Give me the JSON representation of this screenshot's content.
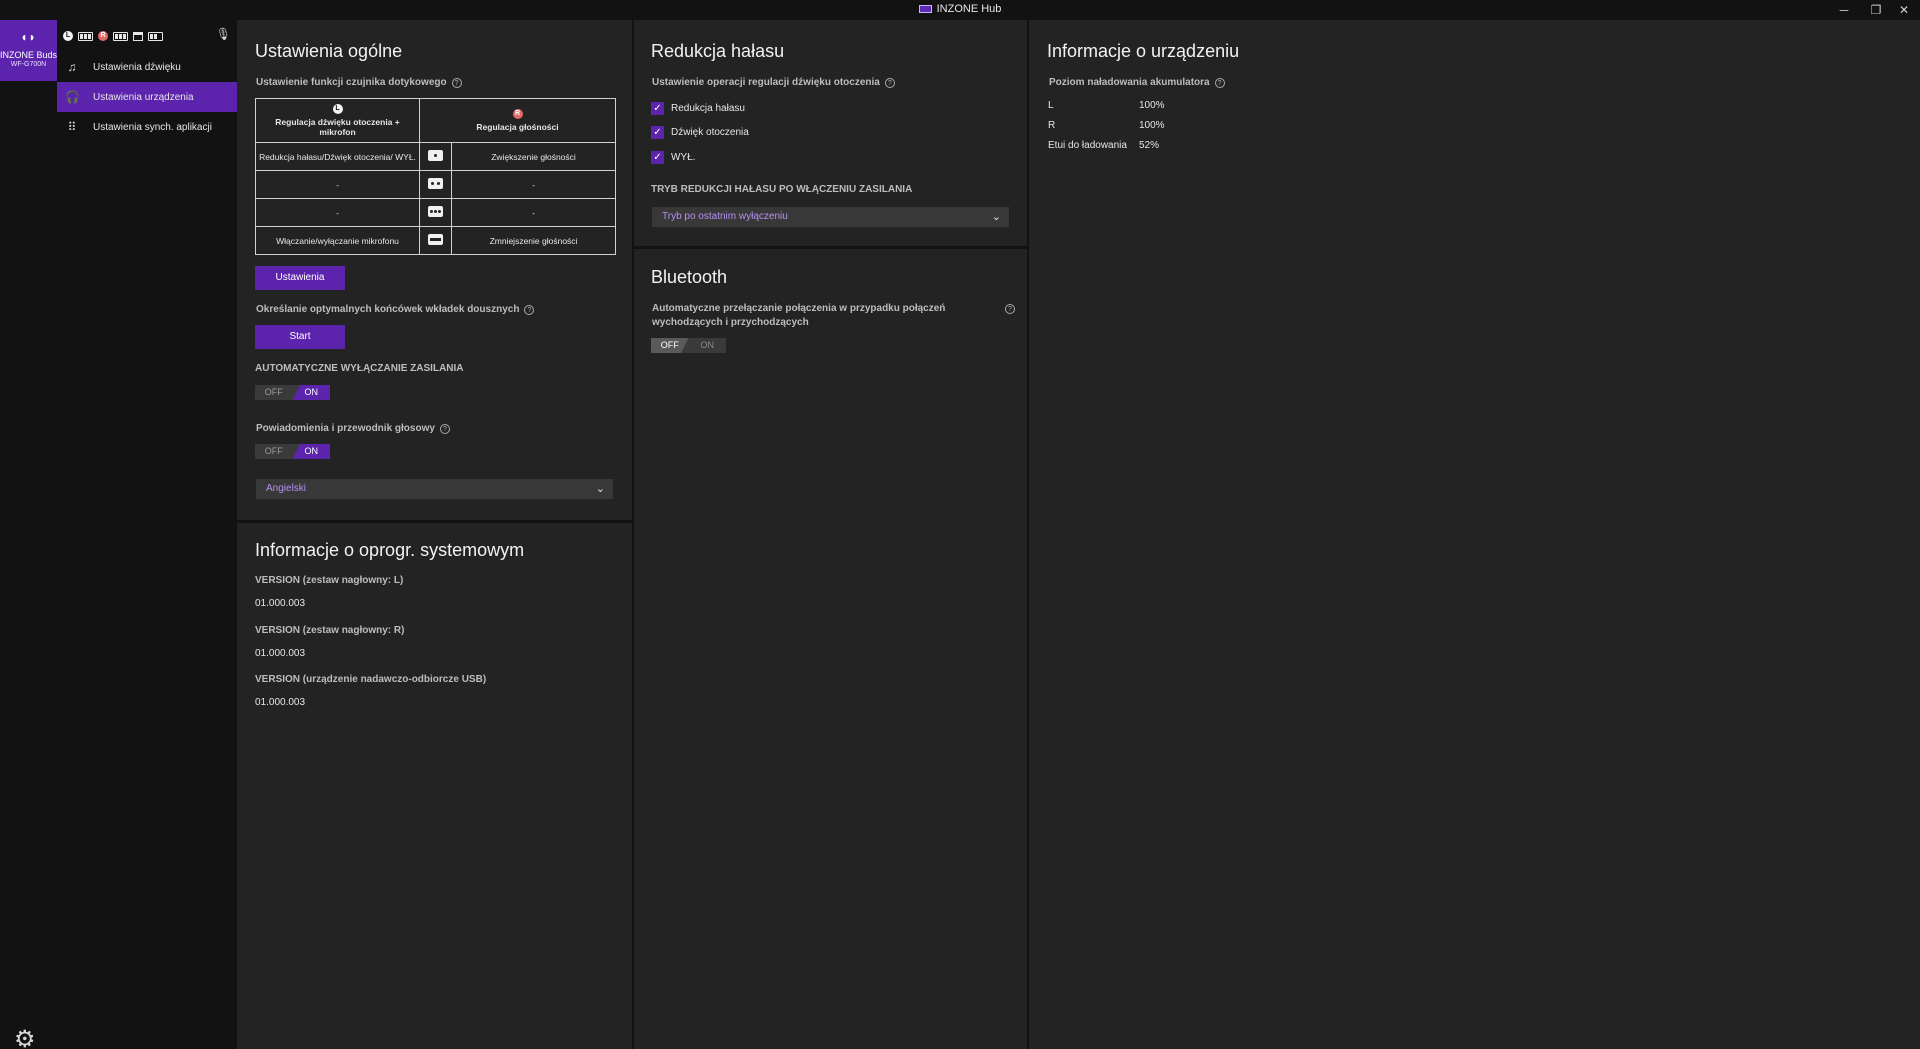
{
  "titlebar": {
    "app_title": "INZONE Hub"
  },
  "device": {
    "name": "INZONE Buds",
    "model": "WF-G700N"
  },
  "nav": {
    "items": [
      {
        "label": "Ustawienia dźwięku"
      },
      {
        "label": "Ustawienia urządzenia"
      },
      {
        "label": "Ustawienia synch. aplikacji"
      }
    ]
  },
  "general": {
    "title": "Ustawienia ogólne",
    "touch_sensor_label": "Ustawienie funkcji czujnika dotykowego",
    "touch_table": {
      "left_header": "Regulacja dźwięku otoczenia + mikrofon",
      "right_header": "Regulacja głośności",
      "left_side": "L",
      "right_side": "R",
      "rows": [
        {
          "left": "Redukcja hałasu/Dźwięk otoczenia/ WYŁ.",
          "right": "Zwiększenie głośności"
        },
        {
          "left": "-",
          "right": "-"
        },
        {
          "left": "-",
          "right": "-"
        },
        {
          "left": "Włączanie/wyłączanie mikrofonu",
          "right": "Zmniejszenie głośności"
        }
      ]
    },
    "settings_button": "Ustawienia",
    "earbud_tips_label": "Określanie optymalnych końcówek wkładek dousznych",
    "start_button": "Start",
    "auto_power_off_label": "AUTOMATYCZNE WYŁĄCZANIE ZASILANIA",
    "auto_power_off": {
      "off": "OFF",
      "on": "ON"
    },
    "notifications_label": "Powiadomienia i przewodnik głosowy",
    "notifications": {
      "off": "OFF",
      "on": "ON"
    },
    "language": "Angielski"
  },
  "firmware": {
    "title": "Informacje o oprogr. systemowym",
    "items": [
      {
        "label": "VERSION (zestaw nagłowny: L)",
        "value": "01.000.003"
      },
      {
        "label": "VERSION (zestaw nagłowny: R)",
        "value": "01.000.003"
      },
      {
        "label": "VERSION (urządzenie nadawczo-odbiorcze USB)",
        "value": "01.000.003"
      }
    ]
  },
  "noise": {
    "title": "Redukcja hałasu",
    "ambient_op_label": "Ustawienie operacji regulacji dźwięku otoczenia",
    "options": [
      {
        "label": "Redukcja hałasu"
      },
      {
        "label": "Dźwięk otoczenia"
      },
      {
        "label": "WYŁ."
      }
    ],
    "power_on_mode_label": "TRYB REDUKCJI HAŁASU PO WŁĄCZENIU ZASILANIA",
    "power_on_mode": "Tryb po ostatnim wyłączeniu"
  },
  "bluetooth": {
    "title": "Bluetooth",
    "auto_switch_label": "Automatyczne przełączanie połączenia w przypadku połączeń wychodzących i przychodzących",
    "auto_switch": {
      "off": "OFF",
      "on": "ON"
    }
  },
  "device_info": {
    "title": "Informacje o urządzeniu",
    "battery_label": "Poziom naładowania akumulatora",
    "battery": [
      {
        "name": "L",
        "value": "100%"
      },
      {
        "name": "R",
        "value": "100%"
      },
      {
        "name": "Etui do ładowania",
        "value": "52%"
      }
    ]
  },
  "colors": {
    "accent": "#5c24ad",
    "panel": "#232323",
    "background": "#121212",
    "select_text": "#b690f2"
  }
}
